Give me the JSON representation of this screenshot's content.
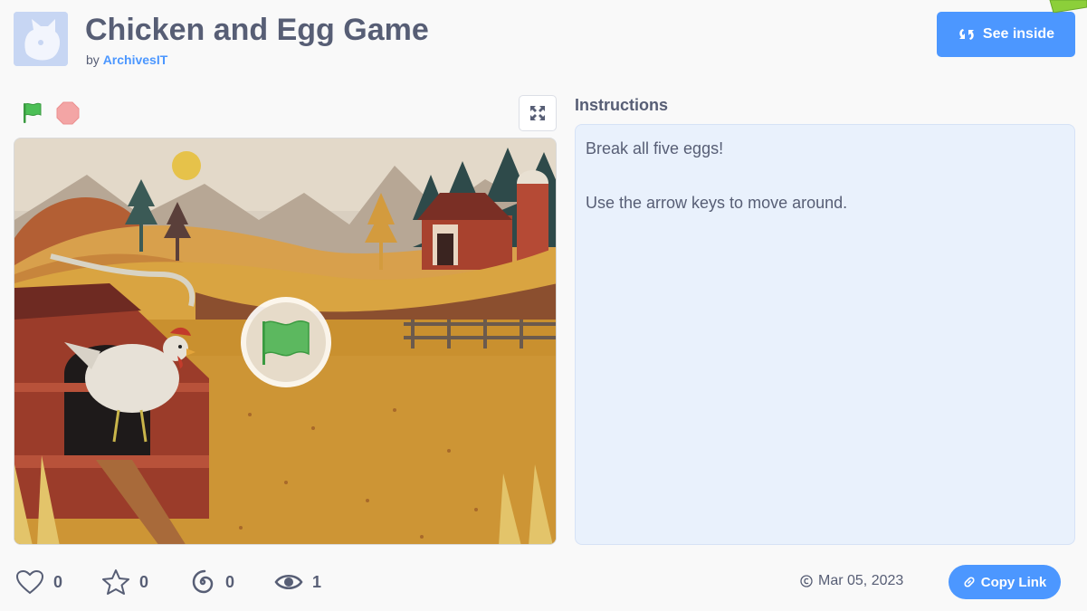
{
  "project": {
    "title": "Chicken and Egg Game",
    "by_prefix": "by",
    "author": "ArchivesIT"
  },
  "header": {
    "see_inside_label": "See inside",
    "see_inside_icon": "remix-icon"
  },
  "controls": {
    "green_flag_icon": "green-flag-icon",
    "stop_icon": "stop-sign-icon",
    "fullscreen_icon": "fullscreen-icon"
  },
  "instructions": {
    "heading": "Instructions",
    "lines": [
      "Break all five eggs!",
      "Use the arrow keys to move around."
    ]
  },
  "stats": {
    "loves": "0",
    "favorites": "0",
    "remixes": "0",
    "views": "1"
  },
  "footer": {
    "date": "Mar 05, 2023",
    "copy_link_label": "Copy Link"
  },
  "colors": {
    "accent": "#4c97ff",
    "text": "#575e75",
    "instructions_bg": "#e9f1fc",
    "flag_green": "#4cbf56",
    "stop_red": "#ec5959"
  }
}
